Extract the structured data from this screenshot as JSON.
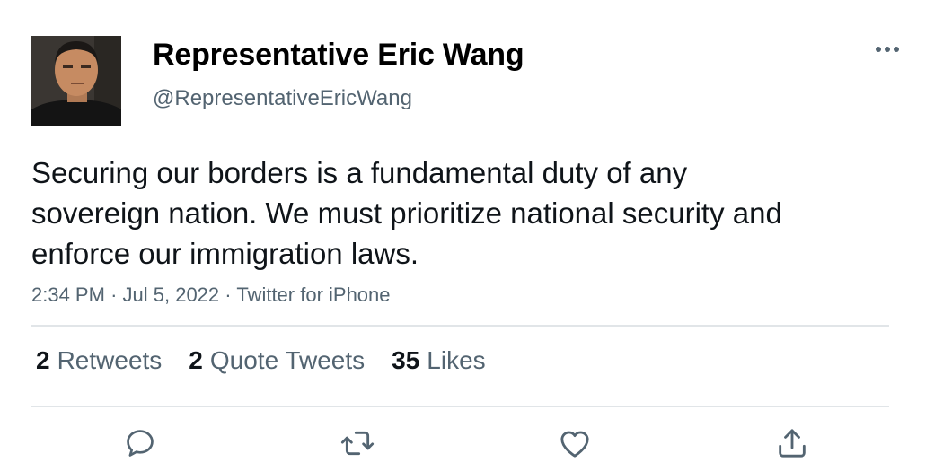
{
  "author": {
    "display_name": "Representative Eric Wang",
    "handle": "@RepresentativeEricWang"
  },
  "tweet": {
    "text": "Securing our borders is a fundamental duty of any sovereign nation. We must prioritize national security and enforce our immigration laws.",
    "time": "2:34 PM",
    "date": "Jul 5, 2022",
    "source": "Twitter for iPhone",
    "separator": "·"
  },
  "stats": [
    {
      "count": "2",
      "label": "Retweets"
    },
    {
      "count": "2",
      "label": "Quote Tweets"
    },
    {
      "count": "35",
      "label": "Likes"
    }
  ],
  "actions": [
    {
      "icon": "reply-icon"
    },
    {
      "icon": "retweet-icon"
    },
    {
      "icon": "like-icon"
    },
    {
      "icon": "share-icon"
    }
  ],
  "colors": {
    "text": "#0f1419",
    "secondary": "#536471",
    "divider": "#e1e5e8"
  }
}
